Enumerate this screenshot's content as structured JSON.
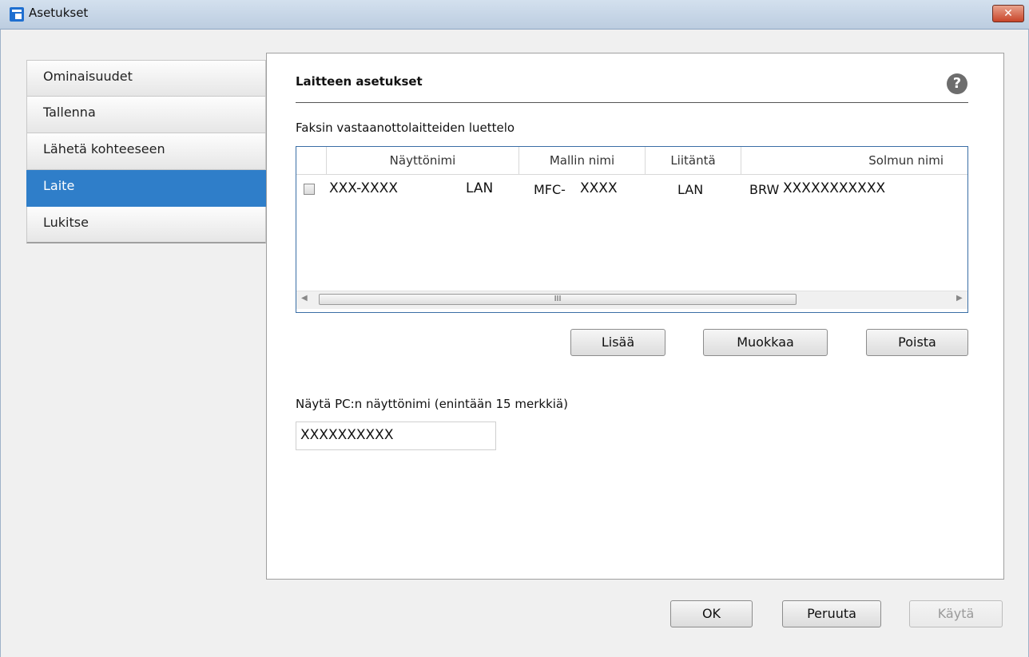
{
  "window": {
    "title": "Asetukset",
    "close_glyph": "✕"
  },
  "sidebar": {
    "items": [
      {
        "label": "Ominaisuudet",
        "selected": false
      },
      {
        "label": "Tallenna",
        "selected": false
      },
      {
        "label": "Lähetä kohteeseen",
        "selected": false
      },
      {
        "label": "Laite",
        "selected": true
      },
      {
        "label": "Lukitse",
        "selected": false
      }
    ]
  },
  "panel": {
    "title": "Laitteen asetukset",
    "help_glyph": "?",
    "list_label": "Faksin vastaanottolaitteiden luettelo",
    "columns": [
      "Näyttönimi",
      "Mallin nimi",
      "Liitäntä",
      "Solmun nimi"
    ],
    "rows": [
      {
        "checked": false,
        "display_name": "XXX-XXXX",
        "display_extra": "LAN",
        "model_prefix": "MFC- ",
        "model": "XXXX",
        "interface": "LAN",
        "node_prefix": "BRW",
        "node": "XXXXXXXXXXX"
      }
    ],
    "scroll_thumb_glyph": "III",
    "buttons": {
      "add": "Lisää",
      "edit": "Muokkaa",
      "delete": "Poista"
    },
    "pc_name_label": "Näytä PC:n näyttönimi (enintään 15 merkkiä)",
    "pc_name_value": "XXXXXXXXXX"
  },
  "footer": {
    "ok": "OK",
    "cancel": "Peruuta",
    "apply": "Käytä"
  },
  "colors": {
    "selected": "#2f7ec9",
    "close": "#c8452a"
  }
}
